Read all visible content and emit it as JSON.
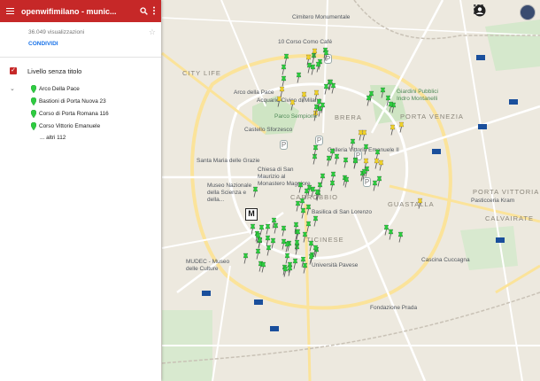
{
  "header": {
    "title": "openwifimilano - munic...",
    "menu_icon": "menu-icon",
    "search_icon": "search-icon",
    "more_icon": "more-vert-icon"
  },
  "map_info": {
    "views": "36.049 visualizzazioni",
    "share": "CONDIVIDI"
  },
  "layer": {
    "title": "Livello senza titolo",
    "items": [
      {
        "label": "Arco Della Pace"
      },
      {
        "label": "Bastioni di Porta Nuova 23"
      },
      {
        "label": "Corso di Porta Romana 116"
      },
      {
        "label": "Corso Vittorio Emanuele"
      }
    ],
    "more": "... altri 112"
  },
  "colors": {
    "header_red": "#c62828",
    "pin_green": "#2ecc40",
    "pin_yellow": "#f1d22a",
    "link_blue": "#1a73e8"
  },
  "map_labels": {
    "city_life": "CITY LIFE",
    "arco_pace": "Arco della Pace",
    "porta_venezia": "PORTA VENEZIA",
    "brera": "BRERA",
    "castello": "Castello Sforzesco",
    "santa_maria": "Santa Maria delle Grazie",
    "san_maurizio": "Chiesa di San Maurizio al Monastero Maggiore",
    "museo": "Museo Nazionale della Scienza e della...",
    "carrobbio": "CARROBBIO",
    "san_lorenzo": "Basilica di San Lorenzo",
    "ticinese": "TICINESE",
    "mudec": "MUDEC - Museo delle Culture",
    "pavese": "Università Pavese",
    "calvairate": "CALVAIRATE",
    "fondazione_prada": "Fondazione Prada",
    "cimitero": "Cimitero Monumentale",
    "como": "10 Corso Como Café",
    "porta_vittoria": "PORTA VITTORIA",
    "guastalla": "GUASTALLA",
    "cucagna": "Cascina Cuccagna",
    "giardini": "Giardini Pubblici Indro Montanelli",
    "acquario": "Acquario Civico di Milano",
    "sempione": "Parco Sempione",
    "vittorio": "Galleria Vittorio Emanuele II",
    "pasticceria": "Pasticceria Kram"
  },
  "metro_letter": "M"
}
